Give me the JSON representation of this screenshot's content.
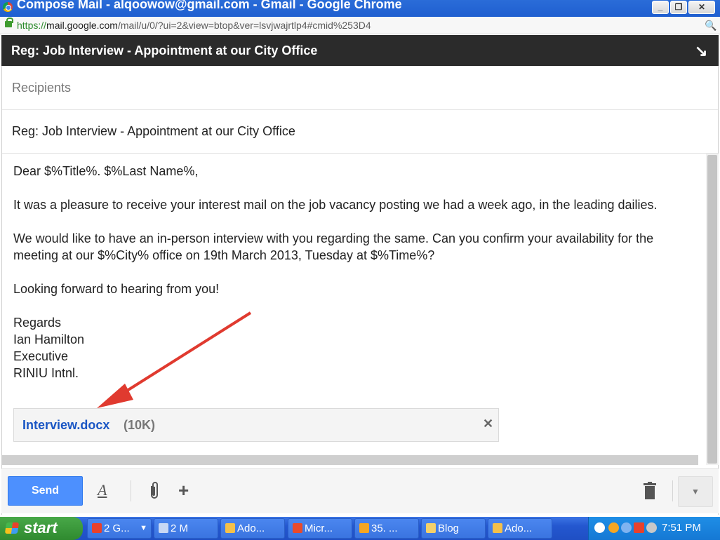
{
  "window": {
    "title": "Compose Mail - alqoowow@gmail.com - Gmail - Google Chrome",
    "minimize": "_",
    "restore": "❐",
    "close": "✕"
  },
  "address_bar": {
    "scheme": "https://",
    "host": "mail.google.com",
    "path": "/mail/u/0/?ui=2&view=btop&ver=lsvjwajrtlp4#cmid%253D4"
  },
  "compose": {
    "header_subject": "Reg: Job Interview - Appointment at our City Office",
    "recipients_placeholder": "Recipients",
    "subject": "Reg: Job Interview - Appointment at our City Office",
    "body": {
      "greeting": "Dear $%Title%. $%Last Name%,",
      "para1": "It was a pleasure to receive your interest mail on the job vacancy posting we had a week ago, in the leading dailies.",
      "para2": "We would like to have an in-person interview with you regarding the same. Can you confirm your availability for the meeting at our $%City% office on 19th March 2013, Tuesday at $%Time%?",
      "para3": "Looking forward to hearing from you!",
      "signoff": "Regards",
      "sig_name": "Ian Hamilton",
      "sig_title": "Executive",
      "sig_company": "RINIU Intnl."
    },
    "attachment": {
      "filename": "Interview.docx",
      "size": "(10K)"
    },
    "toolbar": {
      "send_label": "Send",
      "formatting_icon": "A",
      "attach_icon": "paperclip-icon",
      "insert_icon": "+",
      "discard_icon": "trash-icon",
      "more_icon": "▼"
    }
  },
  "taskbar": {
    "start_label": "start",
    "tasks": [
      {
        "label": "2 G...",
        "icon": "chrome-icon",
        "color": "#e8412c"
      },
      {
        "label": "2 M",
        "icon": "window-icon",
        "color": "#c8d8f4"
      },
      {
        "label": "Ado...",
        "icon": "adobe-icon",
        "color": "#f4c04a"
      },
      {
        "label": "Micr...",
        "icon": "office-icon",
        "color": "#e84a2c"
      },
      {
        "label": "35. ...",
        "icon": "app-icon",
        "color": "#f5a623"
      },
      {
        "label": "Blog",
        "icon": "folder-icon",
        "color": "#f4d06a"
      },
      {
        "label": "Ado...",
        "icon": "adobe-icon",
        "color": "#f4c04a"
      }
    ],
    "clock": "7:51 PM"
  }
}
